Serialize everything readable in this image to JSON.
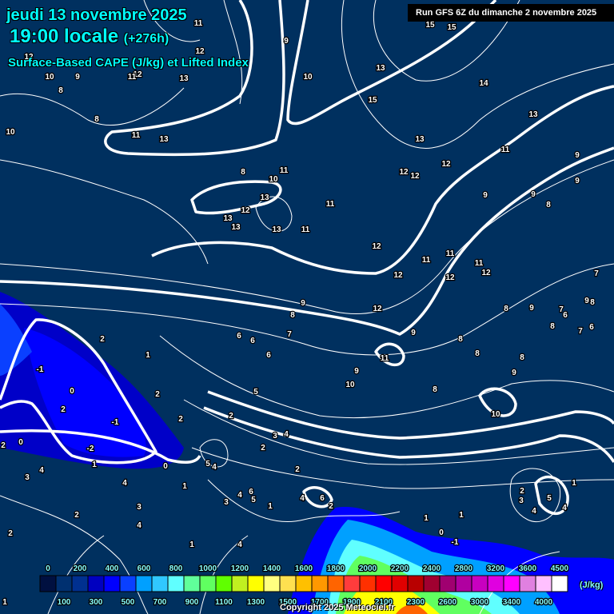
{
  "header": {
    "date": "jeudi 13 novembre 2025",
    "time": "19:00 locale",
    "lead": "(+276h)",
    "parameter": "Surface-Based CAPE (J/kg) et Lifted Index",
    "run": "Run GFS 6Z du dimanche 2 novembre 2025"
  },
  "colorbar": {
    "unit": "(J/kg)",
    "top_labels": [
      "0",
      "200",
      "400",
      "600",
      "800",
      "1000",
      "1200",
      "1400",
      "1600",
      "1800",
      "2000",
      "2200",
      "2400",
      "2800",
      "3200",
      "3600",
      "4500"
    ],
    "bottom_labels": [
      "100",
      "300",
      "500",
      "700",
      "900",
      "1100",
      "1300",
      "1500",
      "1700",
      "1900",
      "2100",
      "2300",
      "2600",
      "3000",
      "3400",
      "4000"
    ],
    "colors": [
      "#001040",
      "#003070",
      "#003090",
      "#0000c0",
      "#0000ff",
      "#0a40ff",
      "#00a0ff",
      "#30c8ff",
      "#60ffff",
      "#60ff9a",
      "#60ff60",
      "#60ff00",
      "#c0f020",
      "#ffff00",
      "#ffff80",
      "#ffe050",
      "#ffc000",
      "#ff9800",
      "#ff6400",
      "#ff3c3c",
      "#ff3000",
      "#ff0000",
      "#e00000",
      "#b80000",
      "#a00030",
      "#a00070",
      "#b000a0",
      "#c800c0",
      "#e000e0",
      "#ff00ff",
      "#e080e0",
      "#ffc0ff",
      "#ffffff"
    ]
  },
  "contour_labels": [
    "11",
    "9",
    "15",
    "15",
    "12",
    "10",
    "9",
    "8",
    "12",
    "11",
    "13",
    "12",
    "10",
    "13",
    "15",
    "14",
    "13",
    "8",
    "10",
    "11",
    "13",
    "13",
    "11",
    "9",
    "12",
    "12",
    "12",
    "8",
    "10",
    "11",
    "9",
    "9",
    "9",
    "8",
    "13",
    "12",
    "13",
    "13",
    "13",
    "11",
    "11",
    "12",
    "11",
    "11",
    "11",
    "12",
    "12",
    "12",
    "7",
    "12",
    "9",
    "8",
    "8",
    "9",
    "7",
    "6",
    "9",
    "8",
    "8",
    "6",
    "7",
    "9",
    "8",
    "8",
    "11",
    "8",
    "6",
    "6",
    "7",
    "6",
    "2",
    "1",
    "-1",
    "9",
    "10",
    "9",
    "8",
    "0",
    "2",
    "2",
    "5",
    "10",
    "-1",
    "2",
    "2",
    "3",
    "4",
    "2",
    "0",
    "2",
    "-2",
    "5",
    "4",
    "1",
    "0",
    "4",
    "3",
    "2",
    "4",
    "1",
    "1",
    "2",
    "3",
    "5",
    "6",
    "5",
    "4",
    "3",
    "4",
    "6",
    "2",
    "3",
    "4",
    "2",
    "1",
    "4",
    "4",
    "1",
    "1",
    "0",
    "-1",
    "2",
    "1",
    "4",
    "1"
  ],
  "footer": {
    "copyright": "Copyright 2025 Meteociel.fr"
  }
}
